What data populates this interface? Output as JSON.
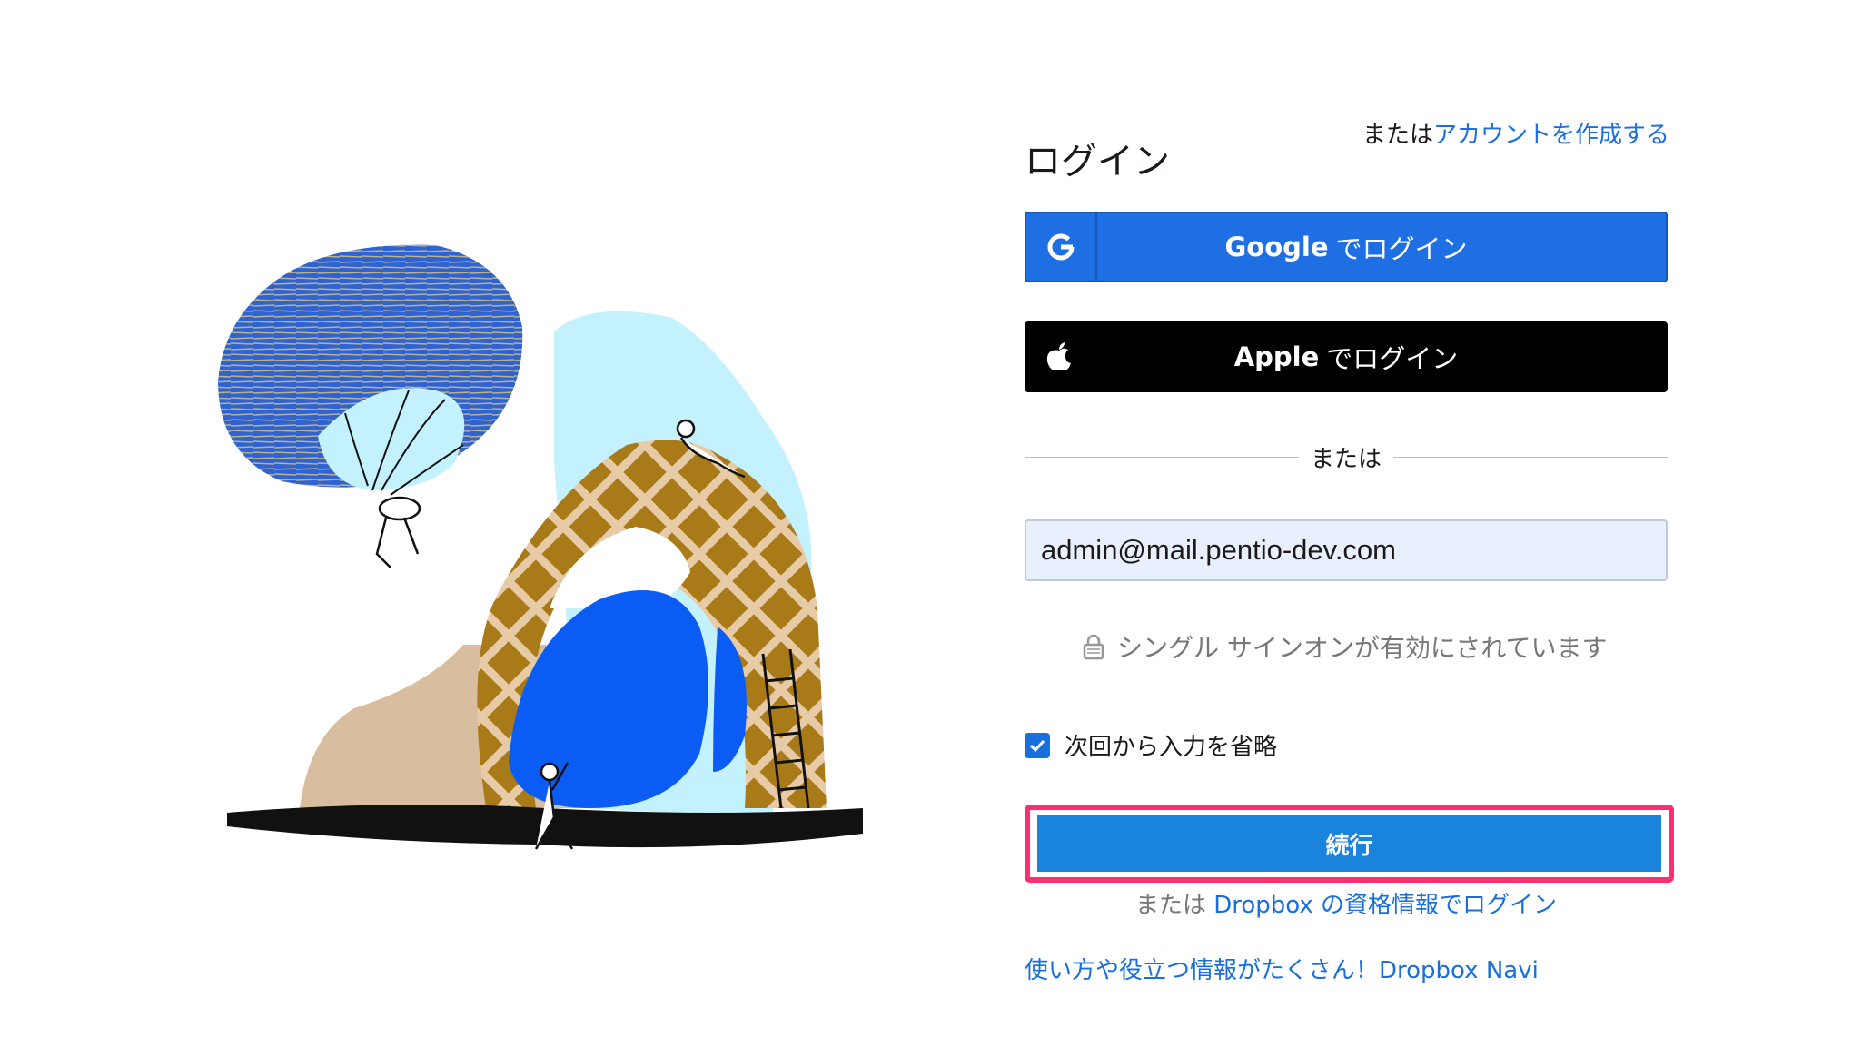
{
  "header": {
    "title": "ログイン",
    "or_text": "または",
    "create_account_link": "アカウントを作成する"
  },
  "sso_buttons": {
    "google": {
      "brand": "Google",
      "label": "でログイン",
      "icon": "google-g-icon"
    },
    "apple": {
      "brand": "Apple",
      "label": "でログイン",
      "icon": "apple-logo-icon"
    }
  },
  "divider_text": "または",
  "email_field": {
    "value": "admin@mail.pentio-dev.com"
  },
  "sso_notice": {
    "icon": "lock-icon",
    "text": "シングル サインオンが有効にされています"
  },
  "remember_me": {
    "label": "次回から入力を省略",
    "checked": true
  },
  "continue_button": {
    "label": "続行"
  },
  "alt_login": {
    "prefix": "または",
    "link": "Dropbox の資格情報でログイン"
  },
  "navi_link": "使い方や役立つ情報がたくさん！Dropbox Navi",
  "colors": {
    "accent_blue": "#1a6fde",
    "google_button": "#1d6fe3",
    "apple_button": "#000000",
    "continue_button": "#1a84dd",
    "highlight_border": "#ff2e6f",
    "email_bg": "#e8f0fe"
  }
}
